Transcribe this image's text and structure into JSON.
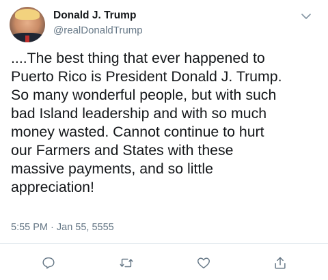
{
  "tweet": {
    "author_name": "Donald J. Trump",
    "author_handle": "@realDonaldTrump",
    "text": "....The best thing that ever happened to\nPuerto Rico is President Donald J. Trump.\nSo many wonderful people, but with such\nbad Island leadership and with so much\nmoney wasted. Cannot continue to hurt\nour Farmers and States with these\nmassive payments, and so little\nappreciation!",
    "timestamp": "5:55 PM · Jan 55, 5555"
  },
  "icons": {
    "menu": "chevron-down-icon",
    "reply": "comment-icon",
    "retweet": "retweet-icon",
    "like": "heart-icon",
    "share": "share-icon"
  },
  "colors": {
    "text": "#14171a",
    "secondary": "#657786",
    "icon": "#657786",
    "divider": "#e6ecf0"
  }
}
